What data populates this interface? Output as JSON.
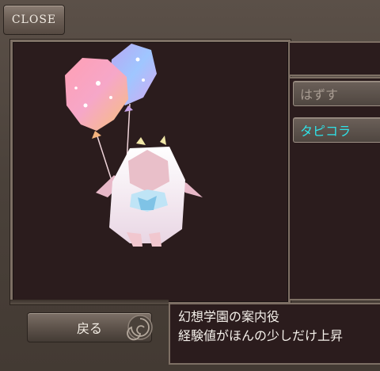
{
  "buttons": {
    "close_label": "CLOSE",
    "back_label": "戻る"
  },
  "side_tabs": {
    "remove_label": "はずす",
    "item_label": "タピコラ"
  },
  "description": {
    "line1": "幻想学園の案内役",
    "line2": "経験値がほんの少しだけ上昇"
  },
  "colors": {
    "panel_bg": "#2b1c1d",
    "frame": "#4a4039",
    "selected_tab_text": "#2fe2e8",
    "balloon_pink": "#f7a6b2",
    "balloon_blue": "#a9c2ff"
  },
  "icons": {
    "close": "close-button",
    "decoration": "swirl-ornament-icon"
  }
}
